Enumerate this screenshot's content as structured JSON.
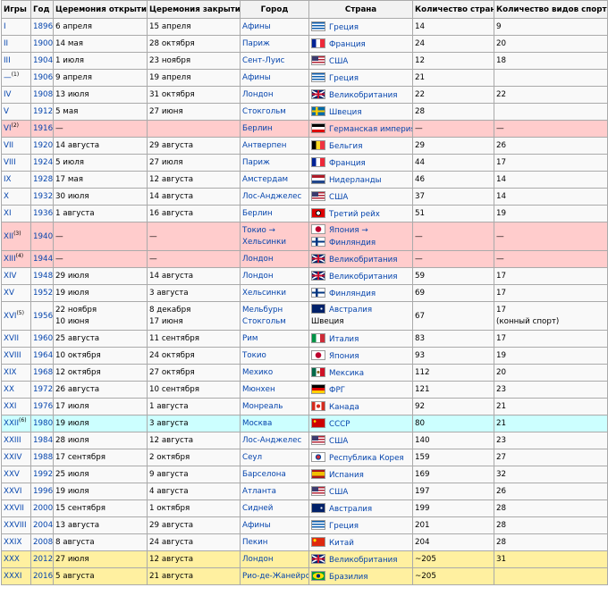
{
  "headers": {
    "games": "Игры",
    "year": "Год",
    "opening": "Церемония открытия",
    "closing": "Церемония закрытия",
    "city": "Город",
    "country": "Страна",
    "nations": "Количество стран",
    "sports": "Количество видов спорта"
  },
  "rows": [
    {
      "games": "I",
      "year": "1896",
      "open": "6 апреля",
      "close": "15 апреля",
      "city": "Афины",
      "country": "Греция",
      "flag": "gr",
      "nations": "14",
      "sports": "9"
    },
    {
      "games": "II",
      "year": "1900",
      "open": "14 мая",
      "close": "28 октября",
      "city": "Париж",
      "country": "Франция",
      "flag": "fr",
      "nations": "24",
      "sports": "20"
    },
    {
      "games": "III",
      "year": "1904",
      "open": "1 июля",
      "close": "23 ноября",
      "city": "Сент-Луис",
      "country": "США",
      "flag": "us",
      "nations": "12",
      "sports": "18"
    },
    {
      "games": "—",
      "sup": "(1)",
      "year": "1906",
      "open": "9 апреля",
      "close": "19 апреля",
      "city": "Афины",
      "country": "Греция",
      "flag": "gr",
      "nations": "21",
      "sports": ""
    },
    {
      "games": "IV",
      "year": "1908",
      "open": "13 июля",
      "close": "31 октября",
      "city": "Лондон",
      "country": "Великобритания",
      "flag": "uk",
      "nations": "22",
      "sports": "22"
    },
    {
      "games": "V",
      "year": "1912",
      "open": "5 мая",
      "close": "27 июня",
      "city": "Стокгольм",
      "country": "Швеция",
      "flag": "se",
      "nations": "28",
      "sports": ""
    },
    {
      "games": "VI",
      "sup": "(2)",
      "year": "1916",
      "open": "—",
      "close": "",
      "city": "Берлин",
      "country": "Германская империя",
      "flag": "de1",
      "nations": "—",
      "sports": "—",
      "style": "pink"
    },
    {
      "games": "VII",
      "year": "1920",
      "open": "14 августа",
      "close": "29 августа",
      "city": "Антверпен",
      "country": "Бельгия",
      "flag": "be",
      "nations": "29",
      "sports": "26"
    },
    {
      "games": "VIII",
      "year": "1924",
      "open": "5 июля",
      "close": "27 июля",
      "city": "Париж",
      "country": "Франция",
      "flag": "fr",
      "nations": "44",
      "sports": "17"
    },
    {
      "games": "IX",
      "year": "1928",
      "open": "17 мая",
      "close": "12 августа",
      "city": "Амстердам",
      "country": "Нидерланды",
      "flag": "nl",
      "nations": "46",
      "sports": "14"
    },
    {
      "games": "X",
      "year": "1932",
      "open": "30 июля",
      "close": "14 августа",
      "city": "Лос-Анджелес",
      "country": "США",
      "flag": "us",
      "nations": "37",
      "sports": "14"
    },
    {
      "games": "XI",
      "year": "1936",
      "open": "1 августа",
      "close": "16 августа",
      "city": "Берлин",
      "country": "Третий рейх",
      "flag": "nz",
      "nations": "51",
      "sports": "19"
    },
    {
      "games": "XII",
      "sup": "(3)",
      "year": "1940",
      "open": "—",
      "close": "—",
      "city": "Токио →",
      "city2": "Хельсинки",
      "country": "Япония →",
      "flag": "jp",
      "country2": "Финляндия",
      "flag2": "fi",
      "nations": "—",
      "sports": "—",
      "style": "pink tall"
    },
    {
      "games": "XIII",
      "sup": "(4)",
      "year": "1944",
      "open": "—",
      "close": "—",
      "city": "Лондон",
      "country": "Великобритания",
      "flag": "uk",
      "nations": "—",
      "sports": "—",
      "style": "pink"
    },
    {
      "games": "XIV",
      "year": "1948",
      "open": "29 июля",
      "close": "14 августа",
      "city": "Лондон",
      "country": "Великобритания",
      "flag": "uk",
      "nations": "59",
      "sports": "17"
    },
    {
      "games": "XV",
      "year": "1952",
      "open": "19 июля",
      "close": "3 августа",
      "city": "Хельсинки",
      "country": "Финляндия",
      "flag": "fi",
      "nations": "69",
      "sports": "17"
    },
    {
      "games": "XVI",
      "sup": "(5)",
      "year": "1956",
      "open": "22 ноября",
      "open2": "10 июня",
      "close": "8 декабря",
      "close2": "17 июня",
      "city": "Мельбурн",
      "city2": "Стокгольм",
      "country": "Австралия",
      "flag": "au",
      "country2": "Швеция",
      "nations": "67",
      "sports": "17",
      "sports2": "(конный спорт)",
      "style": "tall"
    },
    {
      "games": "XVII",
      "year": "1960",
      "open": "25 августа",
      "close": "11 сентября",
      "city": "Рим",
      "country": "Италия",
      "flag": "it",
      "nations": "83",
      "sports": "17"
    },
    {
      "games": "XVIII",
      "year": "1964",
      "open": "10 октября",
      "close": "24 октября",
      "city": "Токио",
      "country": "Япония",
      "flag": "jp",
      "nations": "93",
      "sports": "19"
    },
    {
      "games": "XIX",
      "year": "1968",
      "open": "12 октября",
      "close": "27 октября",
      "city": "Мехико",
      "country": "Мексика",
      "flag": "mx",
      "nations": "112",
      "sports": "20"
    },
    {
      "games": "XX",
      "year": "1972",
      "open": "26 августа",
      "close": "10 сентября",
      "city": "Мюнхен",
      "country": "ФРГ",
      "flag": "de",
      "nations": "121",
      "sports": "23"
    },
    {
      "games": "XXI",
      "year": "1976",
      "open": "17 июля",
      "close": "1 августа",
      "city": "Монреаль",
      "country": "Канада",
      "flag": "ca",
      "nations": "92",
      "sports": "21"
    },
    {
      "games": "XXII",
      "sup": "(6)",
      "year": "1980",
      "open": "19 июля",
      "close": "3 августа",
      "city": "Москва",
      "country": "СССР",
      "flag": "su",
      "nations": "80",
      "sports": "21",
      "style": "cyan"
    },
    {
      "games": "XXIII",
      "year": "1984",
      "open": "28 июля",
      "close": "12 августа",
      "city": "Лос-Анджелес",
      "country": "США",
      "flag": "us",
      "nations": "140",
      "sports": "23"
    },
    {
      "games": "XXIV",
      "year": "1988",
      "open": "17 сентября",
      "close": "2 октября",
      "city": "Сеул",
      "country": "Республика Корея",
      "flag": "kr",
      "nations": "159",
      "sports": "27"
    },
    {
      "games": "XXV",
      "year": "1992",
      "open": "25 июля",
      "close": "9 августа",
      "city": "Барселона",
      "country": "Испания",
      "flag": "es",
      "nations": "169",
      "sports": "32"
    },
    {
      "games": "XXVI",
      "year": "1996",
      "open": "19 июля",
      "close": "4 августа",
      "city": "Атланта",
      "country": "США",
      "flag": "us",
      "nations": "197",
      "sports": "26"
    },
    {
      "games": "XXVII",
      "year": "2000",
      "open": "15 сентября",
      "close": "1 октября",
      "city": "Сидней",
      "country": "Австралия",
      "flag": "au",
      "nations": "199",
      "sports": "28"
    },
    {
      "games": "XXVIII",
      "year": "2004",
      "open": "13 августа",
      "close": "29 августа",
      "city": "Афины",
      "country": "Греция",
      "flag": "gr",
      "nations": "201",
      "sports": "28"
    },
    {
      "games": "XXIX",
      "year": "2008",
      "open": "8 августа",
      "close": "24 августа",
      "city": "Пекин",
      "country": "Китай",
      "flag": "cn",
      "nations": "204",
      "sports": "28"
    },
    {
      "games": "XXX",
      "year": "2012",
      "open": "27 июля",
      "close": "12 августа",
      "city": "Лондон",
      "country": "Великобритания",
      "flag": "uk",
      "nations": "~205",
      "sports": "31",
      "style": "gold"
    },
    {
      "games": "XXXI",
      "year": "2016",
      "open": "5 августа",
      "close": "21 августа",
      "city": "Рио-де-Жанейро",
      "country": "Бразилия",
      "flag": "br",
      "nations": "~205",
      "sports": "",
      "style": "gold"
    }
  ]
}
